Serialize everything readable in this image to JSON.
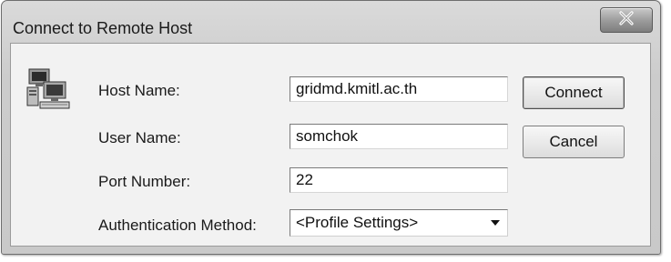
{
  "window": {
    "title": "Connect to Remote Host",
    "close_icon": "close-x-icon"
  },
  "form": {
    "icon": "network-computers-icon",
    "host_name": {
      "label": "Host Name:",
      "value": "gridmd.kmitl.ac.th"
    },
    "user_name": {
      "label": "User Name:",
      "value": "somchok"
    },
    "port_number": {
      "label": "Port Number:",
      "value": "22"
    },
    "auth_method": {
      "label": "Authentication Method:",
      "selected": "<Profile Settings>",
      "arrow_icon": "dropdown-arrow-icon"
    }
  },
  "buttons": {
    "connect": "Connect",
    "cancel": "Cancel"
  }
}
